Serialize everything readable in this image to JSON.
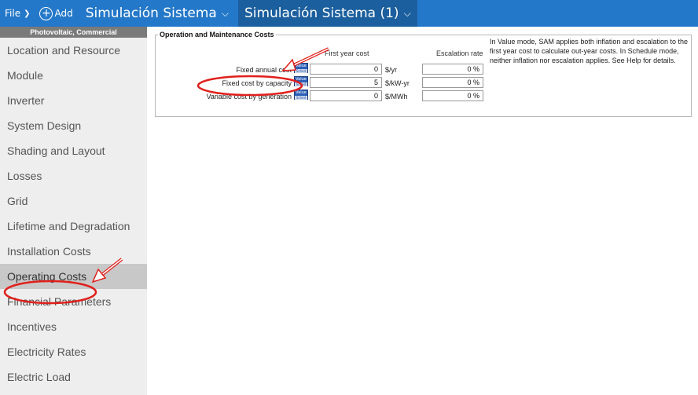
{
  "topbar": {
    "file_label": "File",
    "add_label": "Add",
    "cases": [
      {
        "label": "Simulación Sistema"
      },
      {
        "label": "Simulación Sistema (1)"
      }
    ]
  },
  "sidebar": {
    "header": "Photovoltaic, Commercial",
    "items": [
      {
        "label": "Location and Resource"
      },
      {
        "label": "Module"
      },
      {
        "label": "Inverter"
      },
      {
        "label": "System Design"
      },
      {
        "label": "Shading and Layout"
      },
      {
        "label": "Losses"
      },
      {
        "label": "Grid"
      },
      {
        "label": "Lifetime and Degradation"
      },
      {
        "label": "Installation Costs"
      },
      {
        "label": "Operating Costs"
      },
      {
        "label": "Financial Parameters"
      },
      {
        "label": "Incentives"
      },
      {
        "label": "Electricity Rates"
      },
      {
        "label": "Electric Load"
      }
    ]
  },
  "om": {
    "title": "Operation and Maintenance Costs",
    "col_first_year": "First year cost",
    "col_escalation": "Escalation rate",
    "value_btn_top": "Value",
    "value_btn_bottom": "Sched",
    "rows": [
      {
        "label": "Fixed annual cost",
        "value": "0",
        "unit": "$/yr",
        "escalation": "0 %"
      },
      {
        "label": "Fixed cost by capacity",
        "value": "5",
        "unit": "$/kW-yr",
        "escalation": "0 %"
      },
      {
        "label": "Variable cost by generation",
        "value": "0",
        "unit": "$/MWh",
        "escalation": "0 %"
      }
    ],
    "note": "In Value mode, SAM applies both inflation and escalation to the first year cost to calculate out-year costs. In Schedule mode, neither inflation nor escalation applies. See Help for details."
  }
}
